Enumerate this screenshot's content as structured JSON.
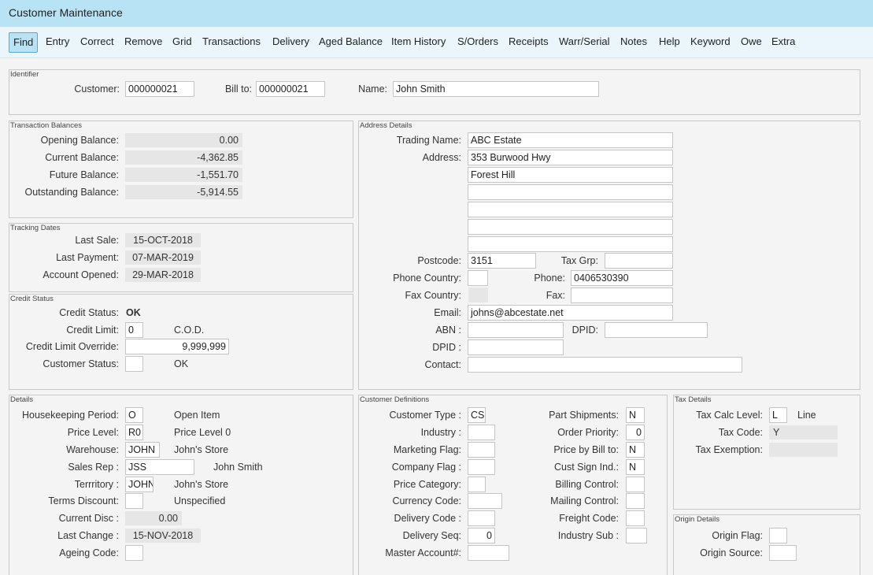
{
  "window": {
    "title": "Customer Maintenance"
  },
  "menu": [
    {
      "label": "Find",
      "active": true
    },
    {
      "label": "Entry"
    },
    {
      "label": "Correct"
    },
    {
      "label": "Remove"
    },
    {
      "label": "Grid"
    },
    {
      "label": "Transactions"
    },
    {
      "label": "Delivery"
    },
    {
      "label": "Aged Balance"
    },
    {
      "label": "Item History"
    },
    {
      "label": "S/Orders"
    },
    {
      "label": "Receipts"
    },
    {
      "label": "Warr/Serial"
    },
    {
      "label": "Notes"
    },
    {
      "label": "Help"
    },
    {
      "label": "Keyword"
    },
    {
      "label": "Owe"
    },
    {
      "label": "Extra"
    }
  ],
  "identifier": {
    "title": "Identifier",
    "customer_label": "Customer:",
    "customer": "000000021",
    "billto_label": "Bill to:",
    "billto": "000000021",
    "name_label": "Name:",
    "name": "John Smith"
  },
  "balances": {
    "title": "Transaction Balances",
    "opening_label": "Opening Balance:",
    "opening": "0.00",
    "current_label": "Current Balance:",
    "current": "-4,362.85",
    "future_label": "Future Balance:",
    "future": "-1,551.70",
    "outstanding_label": "Outstanding Balance:",
    "outstanding": "-5,914.55"
  },
  "tracking": {
    "title": "Tracking Dates",
    "last_sale_label": "Last Sale:",
    "last_sale": "15-OCT-2018",
    "last_payment_label": "Last Payment:",
    "last_payment": "07-MAR-2019",
    "opened_label": "Account Opened:",
    "opened": "29-MAR-2018"
  },
  "credit": {
    "title": "Credit Status",
    "status_label": "Credit Status:",
    "status": "OK",
    "limit_label": "Credit Limit:",
    "limit": "0",
    "limit_desc": "C.O.D.",
    "override_label": "Credit Limit Override:",
    "override": "9,999,999",
    "cust_status_label": "Customer Status:",
    "cust_status": "",
    "cust_status_desc": "OK"
  },
  "address": {
    "title": "Address Details",
    "trading_label": "Trading Name:",
    "trading": "ABC Estate",
    "address_label": "Address:",
    "lines": [
      "353 Burwood Hwy",
      "Forest Hill",
      "",
      "",
      "",
      ""
    ],
    "postcode_label": "Postcode:",
    "postcode": "3151",
    "taxgrp_label": "Tax Grp:",
    "taxgrp": "",
    "phone_country_label": "Phone Country:",
    "phone_country": "",
    "phone_label": "Phone:",
    "phone": "0406530390",
    "fax_country_label": "Fax Country:",
    "fax_country": "",
    "fax_label": "Fax:",
    "fax": "",
    "email_label": "Email:",
    "email": "johns@abcestate.net",
    "abn_label": "ABN :",
    "abn": "",
    "dpid_label": "DPID:",
    "dpid": "",
    "dpid2_label": "DPID :",
    "dpid2": "",
    "contact_label": "Contact:",
    "contact": ""
  },
  "details": {
    "title": "Details",
    "housekeeping_label": "Housekeeping Period:",
    "housekeeping": "O",
    "housekeeping_desc": "Open Item",
    "price_level_label": "Price Level:",
    "price_level": "R0",
    "price_level_desc": "Price Level 0",
    "warehouse_label": "Warehouse:",
    "warehouse": "JOHN",
    "warehouse_desc": "John's Store",
    "sales_rep_label": "Sales Rep :",
    "sales_rep": "JSS",
    "sales_rep_desc": "John Smith",
    "territory_label": "Terrritory :",
    "territory": "JOHN",
    "territory_desc": "John's Store",
    "terms_label": "Terms Discount:",
    "terms": "",
    "terms_desc": "Unspecified",
    "current_disc_label": "Current Disc :",
    "current_disc": "0.00",
    "last_change_label": "Last Change :",
    "last_change": "15-NOV-2018",
    "ageing_label": "Ageing Code:",
    "ageing": ""
  },
  "definitions": {
    "title": "Customer Definitions",
    "cust_type_label": "Customer Type :",
    "cust_type": "CS",
    "industry_label": "Industry :",
    "industry": "",
    "marketing_label": "Marketing Flag:",
    "marketing": "",
    "company_label": "Company Flag :",
    "company": "",
    "price_cat_label": "Price Category:",
    "price_cat": "",
    "currency_label": "Currency Code:",
    "currency": "",
    "delivery_code_label": "Delivery Code :",
    "delivery_code": "",
    "delivery_seq_label": "Delivery Seq:",
    "delivery_seq": "0",
    "master_label": "Master Account#:",
    "master": "",
    "part_ship_label": "Part Shipments:",
    "part_ship": "N",
    "order_priority_label": "Order Priority:",
    "order_priority": "0",
    "price_billto_label": "Price by Bill to:",
    "price_billto": "N",
    "cust_sign_label": "Cust Sign Ind.:",
    "cust_sign": "N",
    "billing_label": "Billing Control:",
    "billing": "",
    "mailing_label": "Mailing Control:",
    "mailing": "",
    "freight_label": "Freight Code:",
    "freight": "",
    "industry_sub_label": "Industry Sub :",
    "industry_sub": ""
  },
  "tax": {
    "title": "Tax Details",
    "calc_label": "Tax Calc Level:",
    "calc": "L",
    "calc_desc": "Line",
    "code_label": "Tax Code:",
    "code": "Y",
    "exemption_label": "Tax Exemption:",
    "exemption": ""
  },
  "origin": {
    "title": "Origin Details",
    "flag_label": "Origin Flag:",
    "flag": "",
    "source_label": "Origin Source:",
    "source": ""
  }
}
